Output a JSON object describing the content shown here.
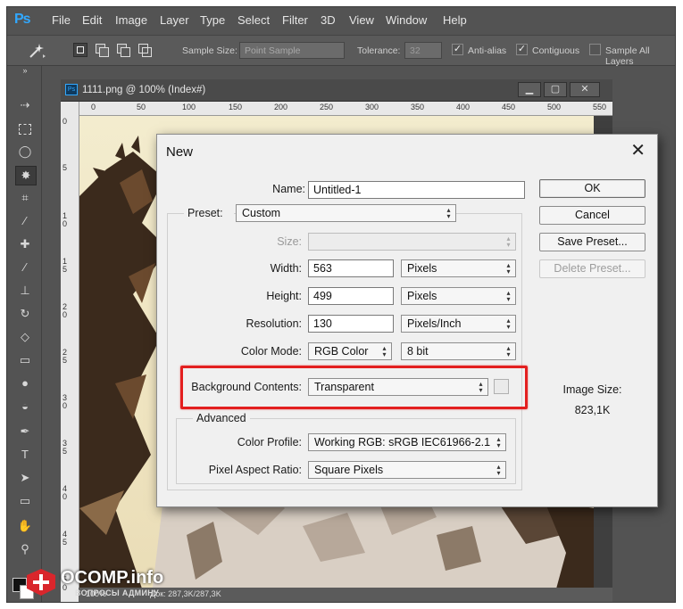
{
  "app": {
    "logo": "Ps",
    "menu": [
      "File",
      "Edit",
      "Image",
      "Layer",
      "Type",
      "Select",
      "Filter",
      "3D",
      "View",
      "Window",
      "Help"
    ]
  },
  "options_bar": {
    "sample_size_label": "Sample Size:",
    "sample_size_value": "Point Sample",
    "tolerance_label": "Tolerance:",
    "tolerance_value": "32",
    "anti_alias_label": "Anti-alias",
    "contiguous_label": "Contiguous",
    "sample_all_layers_label": "Sample All Layers"
  },
  "document": {
    "title": "1111.png @ 100% (Index#)",
    "ruler_h": [
      "0",
      "50",
      "100",
      "150",
      "200",
      "250",
      "300",
      "350",
      "400",
      "450",
      "500",
      "550"
    ],
    "ruler_v": [
      "0",
      "5",
      "1 0",
      "1 5",
      "2 0",
      "2 5",
      "3 0",
      "3 5",
      "4 0",
      "4 5",
      "5 0"
    ],
    "status_zoom": "100%",
    "status_doc": "Док: 287,3K/287,3K"
  },
  "watermark": {
    "brand": "OCOMP.info",
    "tagline": "ВОПРОСЫ АДМИНУ"
  },
  "dialog": {
    "title": "New",
    "name_label": "Name:",
    "name_value": "Untitled-1",
    "preset_label": "Preset:",
    "preset_value": "Custom",
    "size_label": "Size:",
    "size_value": "",
    "width_label": "Width:",
    "width_value": "563",
    "width_unit": "Pixels",
    "height_label": "Height:",
    "height_value": "499",
    "height_unit": "Pixels",
    "resolution_label": "Resolution:",
    "resolution_value": "130",
    "resolution_unit": "Pixels/Inch",
    "color_mode_label": "Color Mode:",
    "color_mode_value": "RGB Color",
    "bit_depth_value": "8 bit",
    "bg_contents_label": "Background Contents:",
    "bg_contents_value": "Transparent",
    "advanced_label": "Advanced",
    "color_profile_label": "Color Profile:",
    "color_profile_value": "Working RGB:  sRGB IEC61966-2.1",
    "pixel_aspect_label": "Pixel Aspect Ratio:",
    "pixel_aspect_value": "Square Pixels",
    "buttons": {
      "ok": "OK",
      "cancel": "Cancel",
      "save_preset": "Save Preset...",
      "delete_preset": "Delete Preset..."
    },
    "image_size_label": "Image Size:",
    "image_size_value": "823,1K"
  },
  "colors": {
    "highlight": "#e31f1f",
    "ps_blue": "#31a8ff",
    "chrome": "#535353"
  }
}
